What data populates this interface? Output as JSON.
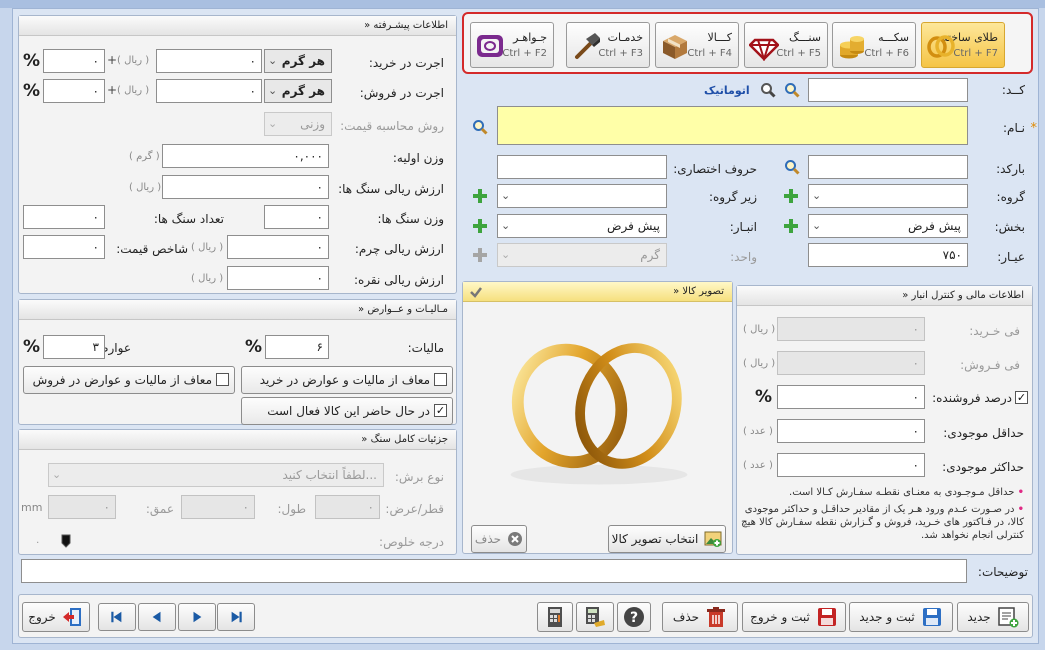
{
  "tiles": [
    {
      "name": "طلای ساخته",
      "key": "Ctrl + F7",
      "icon": "gold-rings-icon",
      "active": true
    },
    {
      "name": "سکـــه",
      "key": "Ctrl + F6",
      "icon": "coin-stack-icon"
    },
    {
      "name": "سنـــگ",
      "key": "Ctrl + F5",
      "icon": "gem-icon"
    },
    {
      "name": "کـــالا",
      "key": "Ctrl + F4",
      "icon": "box-icon"
    },
    {
      "name": "خدمـات",
      "key": "Ctrl + F3",
      "icon": "hammer-icon"
    },
    {
      "name": "جـواهـر",
      "key": "Ctrl + F2",
      "icon": "jewelry-box-icon"
    }
  ],
  "basic": {
    "code_label": "کــد:",
    "auto_link": "اتوماتیک",
    "name_label": "نـام:",
    "required_mark": "*",
    "barcode_label": "بارکد:",
    "abbr_label": "حروف اختصاری:",
    "group_label": "گروه:",
    "subgroup_label": "زیر گروه:",
    "section_label": "بخش:",
    "section_value": "پیش فرض",
    "store_label": "انبـار:",
    "store_value": "پیش فرض",
    "karat_label": "عیـار:",
    "karat_value": "۷۵۰",
    "unit_label": "واحد:",
    "unit_value": "گرم"
  },
  "advanced": {
    "title": "» اطلاعات پیشـرفته",
    "buy_fee_label": "اجرت در خرید:",
    "buy_fee_mode": "هر گرم",
    "buy_fee_value": "۰",
    "buy_fee_extra": "۰",
    "sell_fee_label": "اجرت در فروش:",
    "sell_fee_mode": "هر گرم",
    "sell_fee_value": "۰",
    "sell_fee_extra": "۰",
    "rial_unit": "( ریال )",
    "plus_sign": "+",
    "percent_sign": "%",
    "price_method_label": "روش محاسبه قیمت:",
    "price_method_value": "وزنی",
    "initial_weight_label": "وزن اولیه:",
    "initial_weight_value": "۰,۰۰۰",
    "gram_unit": "( گرم )",
    "stone_value_label": "ارزش ریالی سنگ ها:",
    "stone_value_value": "۰",
    "stone_weight_label": "وزن سنگ ها:",
    "stone_weight_value": "۰",
    "stone_count_label": "تعداد سنگ ها:",
    "stone_count_value": "۰",
    "leather_value_label": "ارزش ریالی چرم:",
    "leather_value_value": "۰",
    "price_index_label": "شاخص قیمت:",
    "price_index_value": "۰",
    "silver_value_label": "ارزش ریالی نقره:",
    "silver_value_value": "۰"
  },
  "tax": {
    "title": "» مـالیـات و عــوارض",
    "tax_label": "مالیات:",
    "tax_value": "۶",
    "duties_label": "عوارض:",
    "duties_value": "۳",
    "exempt_buy_label": "معاف از مالیات و عوارض در خرید",
    "exempt_sell_label": "معاف از مالیات و عوارض در فروش",
    "active_label": "در حال حاضر این کالا فعال است"
  },
  "stone_details": {
    "title": "» جزئیات کامل سنگ",
    "cut_type_label": "نوع برش:",
    "cut_type_value": "لطفاً انتخاب کنید...",
    "diameter_label": "قطر/عرض:",
    "diameter_value": "۰",
    "length_label": "طول:",
    "length_value": "۰",
    "depth_label": "عمق:",
    "depth_value": "۰",
    "mm_unit": "mm",
    "purity_label": "درجه خلوص:",
    "purity_value": "۰"
  },
  "photo": {
    "title": "» تصویر کالا",
    "select_button": "انتخاب تصویر کالا",
    "delete_button": "حذف"
  },
  "finance": {
    "title": "» اطلاعات مالی و کنترل انبار",
    "buy_price_label": "فی خـرید:",
    "buy_price_value": "۰",
    "sell_price_label": "فی فـروش:",
    "sell_price_value": "۰",
    "rial_unit": "( ریال )",
    "supplier_pct_label": "درصد فروشنده:",
    "supplier_pct_value": "۰",
    "percent_sign": "%",
    "min_stock_label": "حداقل موجودی:",
    "min_stock_value": "۰",
    "max_stock_label": "حداکثر موجودی:",
    "max_stock_value": "۰",
    "count_unit": "( عدد )",
    "bullet": "•",
    "note1": "حداقل مـوجـودی به معنـای نقطـه سفـارش کـالا است.",
    "note2": "در صـورت عـدم ورود هـر یک از مقادیر حداقـل و حداکثر موجودی کالا، در فـاکتور های خـرید، فروش و گـزارش نقطه سفـارش کالا هیچ کنترلی انجام نخواهد شد."
  },
  "description_label": "توضیحات:",
  "footer": {
    "new": "جدید",
    "save_new": "ثبت و جدید",
    "save_exit": "ثبت و خروج",
    "delete": "حذف",
    "exit": "خروج"
  }
}
